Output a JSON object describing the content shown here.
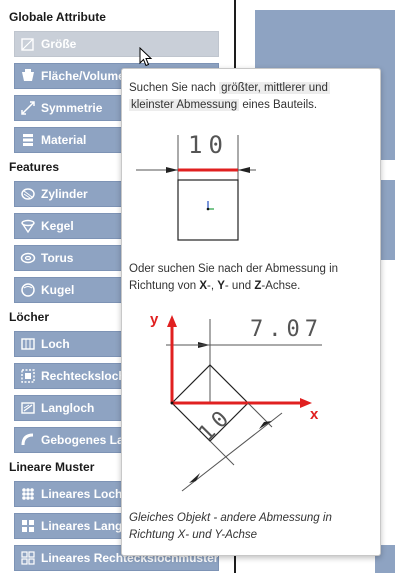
{
  "sections": {
    "global": "Globale Attribute",
    "features": "Features",
    "holes": "Löcher",
    "linear": "Lineare Muster"
  },
  "buttons": {
    "groesse": "Größe",
    "flaeche": "Fläche/Volumen",
    "symmetrie": "Symmetrie",
    "material": "Material",
    "zylinder": "Zylinder",
    "kegel": "Kegel",
    "torus": "Torus",
    "kugel": "Kugel",
    "loch": "Loch",
    "rechtecksloch": "Rechtecksloch",
    "langloch": "Langloch",
    "gebogenes": "Gebogenes Langloch",
    "lin_loch": "Lineares Lochmuster",
    "lin_lang": "Lineares Langlochmuster",
    "lin_rect": "Lineares Rechteckslochmuster"
  },
  "tooltip": {
    "line1a": "Suchen Sie nach",
    "hl1": "größter, mittlerer und",
    "hl2": "kleinster Abmessung",
    "line2b": "eines Bauteils.",
    "dim1": "10",
    "line3": "Oder suchen Sie nach der Abmessung in",
    "line4a": "Richtung von",
    "x": "X",
    "y": "Y",
    "z": "Z",
    "line4sep1": "-,",
    "line4sep2": "- und",
    "line4end": "-Achse.",
    "axis_y": "y",
    "axis_x": "x",
    "dim2": "7.07",
    "dim3": "10",
    "caption1": "Gleiches Objekt - andere Abmessung in",
    "caption2": "Richtung X- und Y-Achse"
  },
  "colors": {
    "button": "#8ea3c2",
    "button_disabled": "#c9cfd8",
    "accent_red": "#e02020",
    "dimension_gray": "#555555"
  }
}
